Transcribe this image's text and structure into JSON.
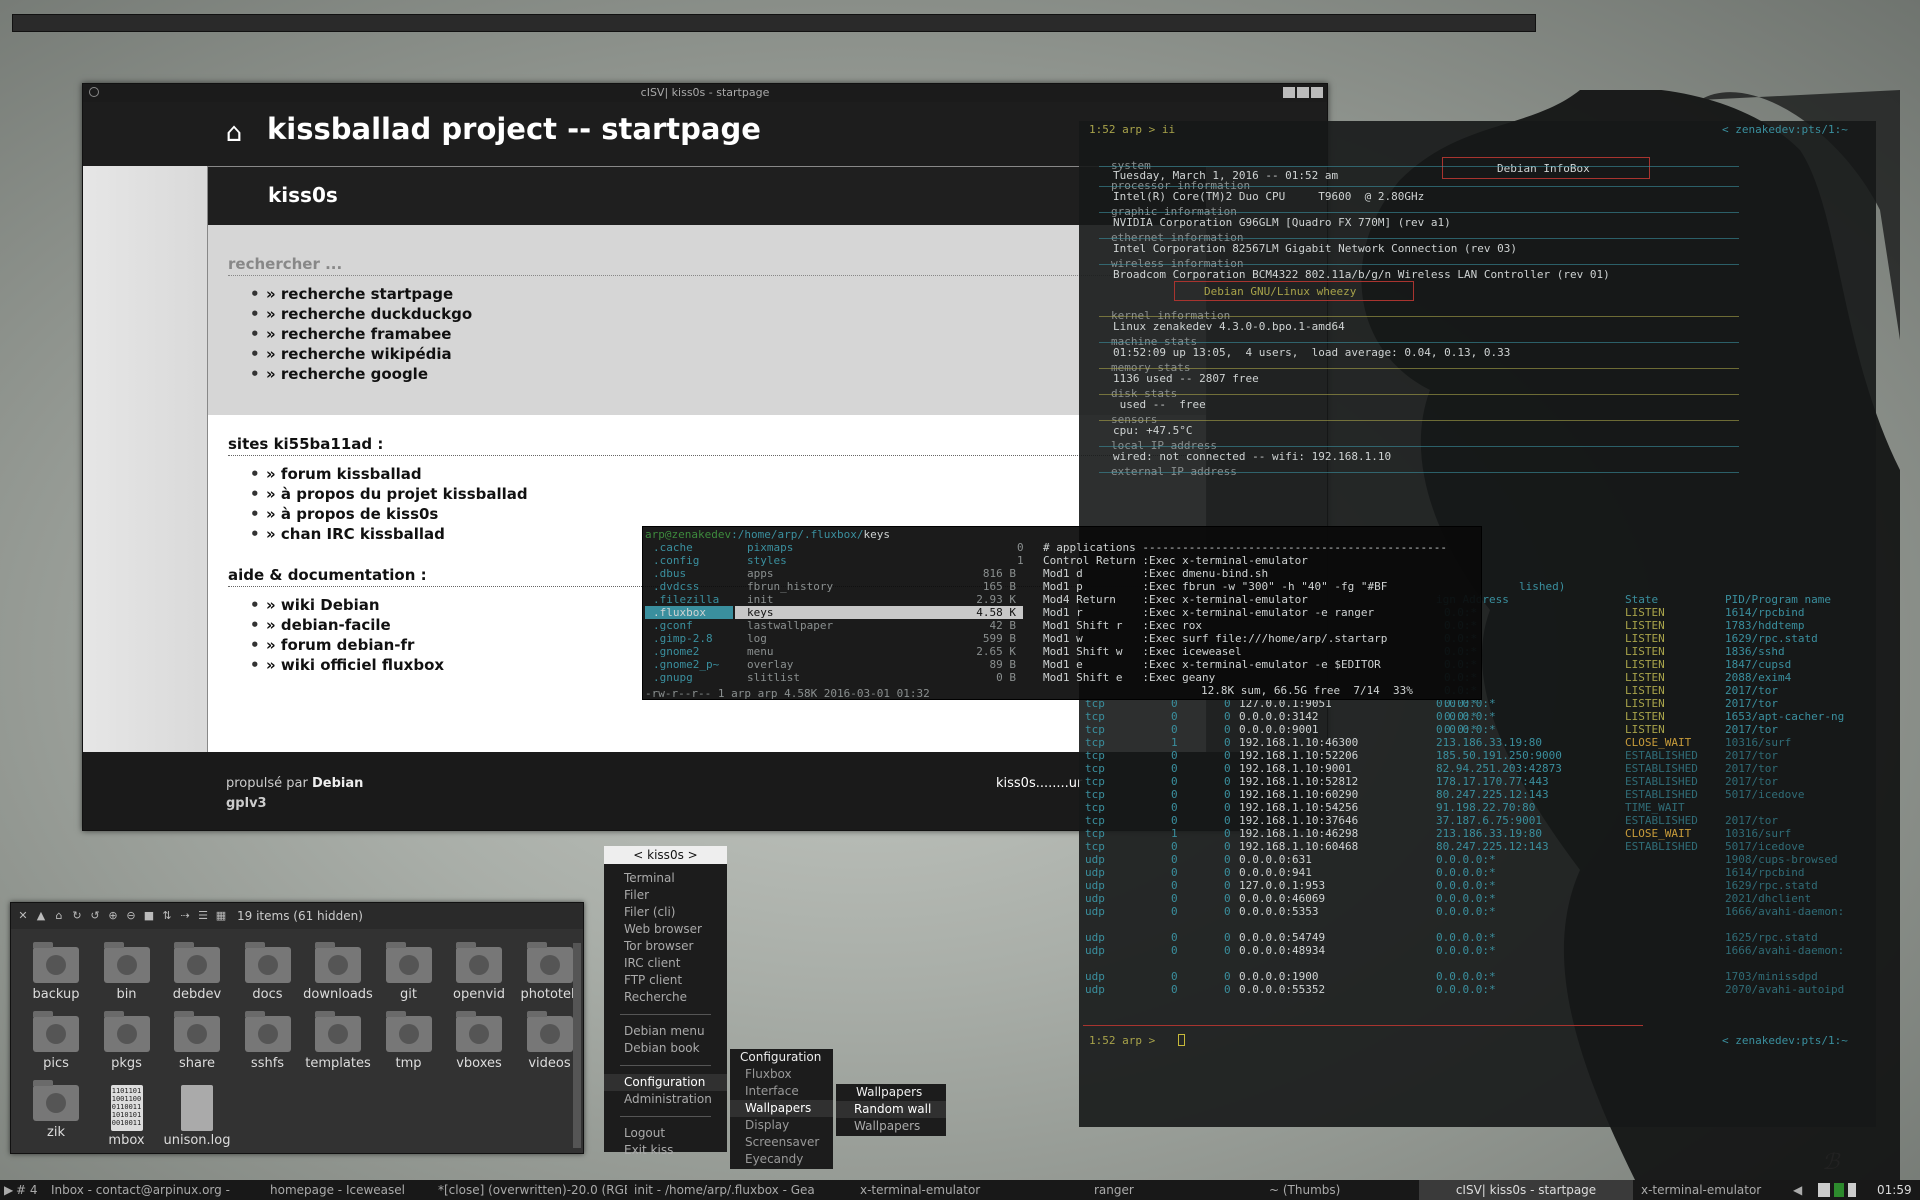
{
  "browser": {
    "window_title": "cISV| kiss0s - startpage",
    "page_title": "kissballad project -- startpage",
    "content_header": "kiss0s",
    "search_label": "rechercher ...",
    "search_links": [
      "» recherche startpage",
      "» recherche duckduckgo",
      "» recherche framabee",
      "» recherche wikipédia",
      "» recherche google"
    ],
    "sites_title": "sites ki55ba11ad :",
    "sites_links": [
      "» forum kissballad",
      "» à propos du projet kissballad",
      "» à propos de kiss0s",
      "» chan IRC kissballad"
    ],
    "help_title": "aide & documentation :",
    "help_links": [
      "» wiki Debian",
      "» debian-facile",
      "» forum debian-fr",
      "» wiki officiel fluxbox"
    ],
    "footer_powered": "propulsé par",
    "footer_debian": "Debian",
    "footer_license": "gplv3",
    "footer_right": "kiss0s........ur"
  },
  "file_manager": {
    "status": "19 items (61 hidden)",
    "items": [
      {
        "name": "backup",
        "icon": "backup-icon"
      },
      {
        "name": "bin",
        "icon": "gear-icon"
      },
      {
        "name": "debdev",
        "icon": "debian-icon"
      },
      {
        "name": "docs",
        "icon": "docs-icon"
      },
      {
        "name": "downloads",
        "icon": "download-icon"
      },
      {
        "name": "git",
        "icon": "git-icon"
      },
      {
        "name": "openvid",
        "icon": "video-icon"
      },
      {
        "name": "phototek",
        "icon": "photo-icon"
      },
      {
        "name": "pics",
        "icon": "pictures-icon"
      },
      {
        "name": "pkgs",
        "icon": "package-icon"
      },
      {
        "name": "share",
        "icon": "share-icon"
      },
      {
        "name": "sshfs",
        "icon": "network-icon"
      },
      {
        "name": "templates",
        "icon": "templates-icon"
      },
      {
        "name": "tmp",
        "icon": "clock-icon"
      },
      {
        "name": "vboxes",
        "icon": "box-icon"
      },
      {
        "name": "videos",
        "icon": "film-icon"
      },
      {
        "name": "zik",
        "icon": "headphones-icon"
      },
      {
        "name": "mbox",
        "icon": "binary-file-icon"
      },
      {
        "name": "unison.log",
        "icon": "text-file-icon"
      }
    ]
  },
  "terminal": {
    "prompt_top": "1:52 arp > ii",
    "prompt_top_right": "< zenakedev:pts/1:~",
    "infobox_title": "Debian InfoBox",
    "lines": [
      "Tuesday, March 1, 2016 -- 01:52 am",
      "Intel(R) Core(TM)2 Duo CPU     T9600  @ 2.80GHz",
      "NVIDIA Corporation G96GLM [Quadro FX 770M] (rev a1)",
      "Intel Corporation 82567LM Gigabit Network Connection (rev 03)",
      "Broadcom Corporation BCM4322 802.11a/b/g/n Wireless LAN Controller (rev 01)",
      "Linux zenakedev 4.3.0-0.bpo.1-amd64",
      "01:52:09 up 13:05,  4 users,  load average: 0.04, 0.13, 0.33",
      "1136 used -- 2807 free",
      " used --  free",
      "cpu: +47.5°C",
      "wired: not connected -- wifi: 192.168.1.10"
    ],
    "section_labels": [
      "system",
      "processor information",
      "graphic information",
      "ethernet information",
      "wireless information",
      "kernel information",
      "machine stats",
      "memory stats",
      "disk stats",
      "sensors",
      "local IP address",
      "external IP address"
    ],
    "distro_label": "Debian GNU/Linux wheezy",
    "net_header_left": "lished)",
    "net_header_mid": "ign Address",
    "net_header_state": "State",
    "net_header_prog": "PID/Program name",
    "listen_rows": [
      {
        "a": "0.0:*",
        "s": "LISTEN",
        "p": "1614/rpcbind"
      },
      {
        "a": "0.0:*",
        "s": "LISTEN",
        "p": "1783/hddtemp"
      },
      {
        "a": "0.0:*",
        "s": "LISTEN",
        "p": "1629/rpc.statd"
      },
      {
        "a": "0.0:*",
        "s": "LISTEN",
        "p": "1836/sshd"
      },
      {
        "a": "0.0:*",
        "s": "LISTEN",
        "p": "1847/cupsd"
      },
      {
        "a": "0.0:*",
        "s": "LISTEN",
        "p": "2088/exim4"
      },
      {
        "a": "0.0:*",
        "s": "LISTEN",
        "p": "2017/tor"
      },
      {
        "a": "0.0:*",
        "s": "LISTEN",
        "p": "2017/tor"
      },
      {
        "a": "0.0:*",
        "s": "LISTEN",
        "p": "1653/apt-cacher-ng"
      },
      {
        "a": "0.0:*",
        "s": "LISTEN",
        "p": "2017/tor"
      }
    ],
    "net_rows": [
      {
        "proto": "tcp",
        "r": "0",
        "s": "0",
        "local": "127.0.0.1:9051",
        "foreign": "0.0.0.0:*",
        "state": "",
        "prog": ""
      },
      {
        "proto": "tcp",
        "r": "0",
        "s": "0",
        "local": "0.0.0.0:3142",
        "foreign": "0.0.0.0:*",
        "state": "",
        "prog": ""
      },
      {
        "proto": "tcp",
        "r": "0",
        "s": "0",
        "local": "0.0.0.0:9001",
        "foreign": "0.0.0.0:*",
        "state": "",
        "prog": ""
      },
      {
        "proto": "tcp",
        "r": "1",
        "s": "0",
        "local": "192.168.1.10:46300",
        "foreign": "213.186.33.19:80",
        "state": "CLOSE_WAIT",
        "prog": "10316/surf"
      },
      {
        "proto": "tcp",
        "r": "0",
        "s": "0",
        "local": "192.168.1.10:52206",
        "foreign": "185.50.191.250:9000",
        "state": "ESTABLISHED",
        "prog": "2017/tor"
      },
      {
        "proto": "tcp",
        "r": "0",
        "s": "0",
        "local": "192.168.1.10:9001",
        "foreign": "82.94.251.203:42873",
        "state": "ESTABLISHED",
        "prog": "2017/tor"
      },
      {
        "proto": "tcp",
        "r": "0",
        "s": "0",
        "local": "192.168.1.10:52812",
        "foreign": "178.17.170.77:443",
        "state": "ESTABLISHED",
        "prog": "2017/tor"
      },
      {
        "proto": "tcp",
        "r": "0",
        "s": "0",
        "local": "192.168.1.10:60290",
        "foreign": "80.247.225.12:143",
        "state": "ESTABLISHED",
        "prog": "5017/icedove"
      },
      {
        "proto": "tcp",
        "r": "0",
        "s": "0",
        "local": "192.168.1.10:54256",
        "foreign": "91.198.22.70:80",
        "state": "TIME_WAIT",
        "prog": ""
      },
      {
        "proto": "tcp",
        "r": "0",
        "s": "0",
        "local": "192.168.1.10:37646",
        "foreign": "37.187.6.75:9001",
        "state": "ESTABLISHED",
        "prog": "2017/tor"
      },
      {
        "proto": "tcp",
        "r": "1",
        "s": "0",
        "local": "192.168.1.10:46298",
        "foreign": "213.186.33.19:80",
        "state": "CLOSE_WAIT",
        "prog": "10316/surf"
      },
      {
        "proto": "tcp",
        "r": "0",
        "s": "0",
        "local": "192.168.1.10:60468",
        "foreign": "80.247.225.12:143",
        "state": "ESTABLISHED",
        "prog": "5017/icedove"
      },
      {
        "proto": "udp",
        "r": "0",
        "s": "0",
        "local": "0.0.0.0:631",
        "foreign": "0.0.0.0:*",
        "state": "",
        "prog": "1908/cups-browsed"
      },
      {
        "proto": "udp",
        "r": "0",
        "s": "0",
        "local": "0.0.0.0:941",
        "foreign": "0.0.0.0:*",
        "state": "",
        "prog": "1614/rpcbind"
      },
      {
        "proto": "udp",
        "r": "0",
        "s": "0",
        "local": "127.0.0.1:953",
        "foreign": "0.0.0.0:*",
        "state": "",
        "prog": "1629/rpc.statd"
      },
      {
        "proto": "udp",
        "r": "0",
        "s": "0",
        "local": "0.0.0.0:46069",
        "foreign": "0.0.0.0:*",
        "state": "",
        "prog": "2021/dhclient"
      },
      {
        "proto": "udp",
        "r": "0",
        "s": "0",
        "local": "0.0.0.0:5353",
        "foreign": "0.0.0.0:*",
        "state": "",
        "prog": "1666/avahi-daemon:"
      },
      {
        "proto": "",
        "r": "",
        "s": "",
        "local": "",
        "foreign": "",
        "state": "",
        "prog": ""
      },
      {
        "proto": "udp",
        "r": "0",
        "s": "0",
        "local": "0.0.0.0:54749",
        "foreign": "0.0.0.0:*",
        "state": "",
        "prog": "1625/rpc.statd"
      },
      {
        "proto": "udp",
        "r": "0",
        "s": "0",
        "local": "0.0.0.0:48934",
        "foreign": "0.0.0.0:*",
        "state": "",
        "prog": "1666/avahi-daemon:"
      },
      {
        "proto": "",
        "r": "",
        "s": "",
        "local": "",
        "foreign": "",
        "state": "",
        "prog": ""
      },
      {
        "proto": "udp",
        "r": "0",
        "s": "0",
        "local": "0.0.0.0:1900",
        "foreign": "0.0.0.0:*",
        "state": "",
        "prog": "1703/minissdpd"
      },
      {
        "proto": "udp",
        "r": "0",
        "s": "0",
        "local": "0.0.0.0:55352",
        "foreign": "0.0.0.0:*",
        "state": "",
        "prog": "2070/avahi-autoipd"
      }
    ],
    "prompt_bottom": "1:52 arp > ",
    "prompt_bottom_right": "< zenakedev:pts/1:~"
  },
  "ranger": {
    "path_user": "arp@zenakedev",
    "path_dir": ":/home/arp/.fluxbox/",
    "path_file": "keys",
    "col1": [
      ".cache",
      ".config",
      ".dbus",
      ".dvdcss",
      ".filezilla",
      ".fluxbox",
      ".gconf",
      ".gimp-2.8",
      ".gnome2",
      ".gnome2_p~",
      ".gnupg"
    ],
    "col1_sizes": [
      "0",
      "1",
      "",
      "",
      "",
      "",
      "",
      "",
      "",
      "",
      ""
    ],
    "col2": [
      "pixmaps",
      "styles",
      "apps",
      "fbrun_history",
      "init",
      "keys",
      "lastwallpaper",
      "log",
      "menu",
      "overlay",
      "slitlist"
    ],
    "col2_sizes": [
      "",
      "",
      "816 B",
      "165 B",
      "2.93 K",
      "4.58 K",
      "42 B",
      "599 B",
      "2.65 K",
      "89 B",
      "0 B"
    ],
    "preview": [
      "# applications ----------------------------------------------",
      "Control Return :Exec x-terminal-emulator",
      "Mod1 d         :Exec dmenu-bind.sh",
      "Mod1 p         :Exec fbrun -w \"300\" -h \"40\" -fg \"#BF",
      "Mod4 Return    :Exec x-terminal-emulator",
      "Mod1 r         :Exec x-terminal-emulator -e ranger",
      "Mod1 Shift r   :Exec rox",
      "Mod1 w         :Exec surf file:///home/arp/.startarp",
      "Mod1 Shift w   :Exec iceweasel",
      "Mod1 e         :Exec x-terminal-emulator -e $EDITOR",
      "Mod1 Shift e   :Exec geany"
    ],
    "summary": "12.8K sum, 66.5G free  7/14  33%",
    "status": "-rw-r--r-- 1 arp arp 4.58K 2016-03-01 01:32"
  },
  "menu": {
    "title": "< kiss0s >",
    "items": [
      "Terminal",
      "Filer",
      "Filer (cli)",
      "Web browser",
      "Tor browser",
      "IRC client",
      "FTP client",
      "Recherche"
    ],
    "items2": [
      "Debian menu",
      "Debian book"
    ],
    "items3": [
      "Configuration",
      "Administration"
    ],
    "items4": [
      "Logout",
      "Exit kiss"
    ],
    "sub_title": "Configuration",
    "sub_items": [
      "Fluxbox",
      "Interface",
      "Wallpapers",
      "Display",
      "Screensaver",
      "Eyecandy"
    ],
    "sub2_title": "Wallpapers",
    "sub2_items": [
      "Random wall",
      "Wallpapers"
    ]
  },
  "taskbar": {
    "workspace": "# 4",
    "tasks": [
      "Inbox - contact@arpinux.org -",
      "homepage - Iceweasel",
      "*[close] (overwritten)-20.0 (RGB",
      "init - /home/arp/.fluxbox - Gea",
      "x-terminal-emulator",
      "ranger",
      "~ (Thumbs)",
      "cISV| kiss0s - startpage",
      "x-terminal-emulator"
    ],
    "clock": "01:59"
  },
  "colors": {
    "accent_cyan": "#3a8f9e",
    "listen_yellow": "#a8a34a",
    "established": "#3d6f7a",
    "close_wait": "#c79b3a",
    "box_red": "#a8342f"
  }
}
